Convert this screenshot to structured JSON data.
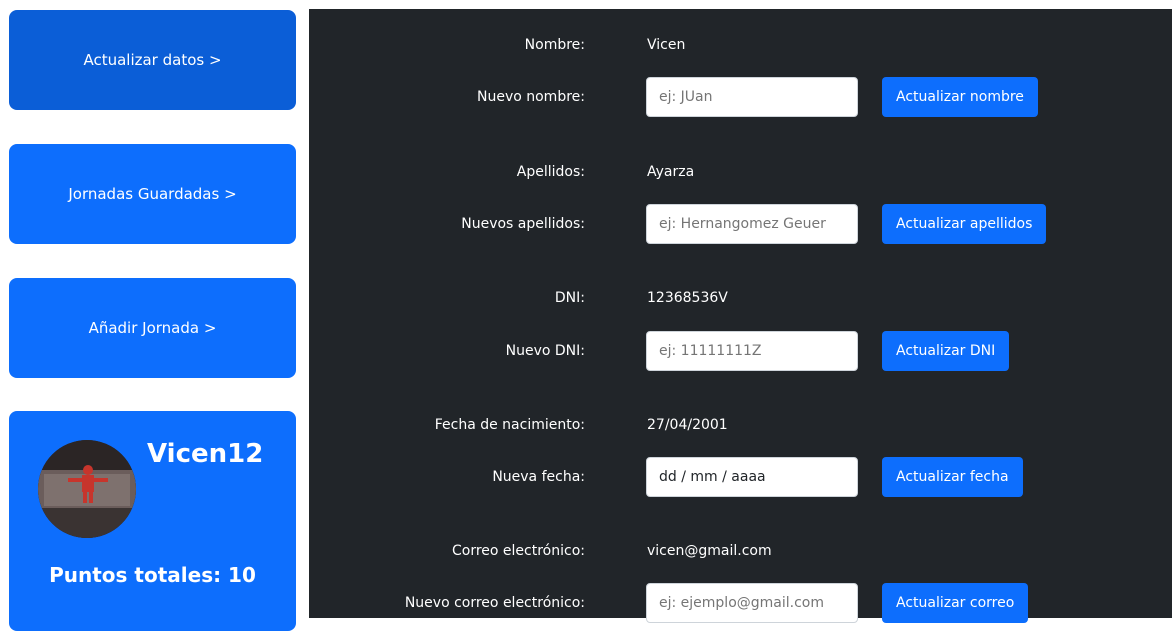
{
  "sidebar": {
    "items": [
      {
        "label": "Actualizar datos >"
      },
      {
        "label": "Jornadas Guardadas >"
      },
      {
        "label": "Añadir Jornada >"
      }
    ],
    "profile": {
      "username": "Vicen12",
      "points_label": "Puntos totales: 10"
    }
  },
  "form": {
    "fields": [
      {
        "current_label": "Nombre:",
        "current_value": "Vicen",
        "new_label": "Nuevo nombre:",
        "placeholder": "ej: JUan",
        "button": "Actualizar nombre"
      },
      {
        "current_label": "Apellidos:",
        "current_value": "Ayarza",
        "new_label": "Nuevos apellidos:",
        "placeholder": "ej: Hernangomez Geuer",
        "button": "Actualizar apellidos"
      },
      {
        "current_label": "DNI:",
        "current_value": "12368536V",
        "new_label": "Nuevo DNI:",
        "placeholder": "ej: 11111111Z",
        "button": "Actualizar DNI"
      },
      {
        "current_label": "Fecha de nacimiento:",
        "current_value": "27/04/2001",
        "new_label": "Nueva fecha:",
        "placeholder": "dd / mm / aaaa",
        "button": "Actualizar fecha"
      },
      {
        "current_label": "Correo electrónico:",
        "current_value": "vicen@gmail.com",
        "new_label": "Nuevo correo electrónico:",
        "placeholder": "ej: ejemplo@gmail.com",
        "button": "Actualizar correo"
      }
    ]
  },
  "colors": {
    "primary": "#0d6efd",
    "panel_bg": "#212529"
  }
}
